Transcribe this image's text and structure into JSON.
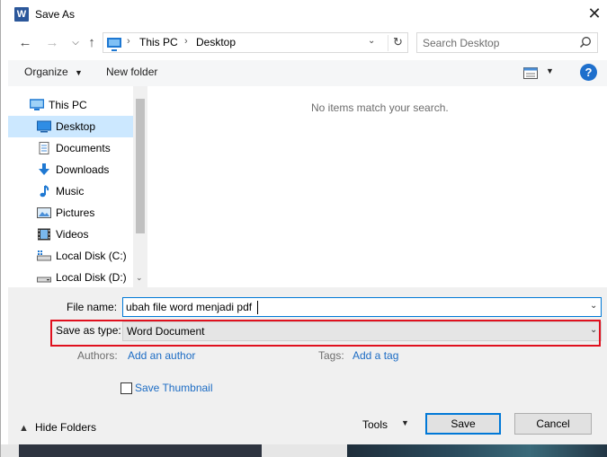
{
  "window": {
    "title": "Save As",
    "app_icon_letter": "W",
    "close_glyph": "✕"
  },
  "address_bar": {
    "breadcrumbs": [
      "This PC",
      "Desktop"
    ],
    "separator": "›"
  },
  "search": {
    "placeholder": "Search Desktop"
  },
  "toolbar": {
    "organize_label": "Organize",
    "new_folder_label": "New folder",
    "help_label": "?"
  },
  "sidebar": {
    "items": [
      {
        "label": "This PC",
        "icon": "pc-icon"
      },
      {
        "label": "Desktop",
        "icon": "desktop-icon",
        "selected": true
      },
      {
        "label": "Documents",
        "icon": "documents-icon"
      },
      {
        "label": "Downloads",
        "icon": "downloads-icon"
      },
      {
        "label": "Music",
        "icon": "music-icon"
      },
      {
        "label": "Pictures",
        "icon": "pictures-icon"
      },
      {
        "label": "Videos",
        "icon": "videos-icon"
      },
      {
        "label": "Local Disk (C:)",
        "icon": "disk-c-icon"
      },
      {
        "label": "Local Disk (D:)",
        "icon": "disk-d-icon"
      }
    ]
  },
  "content": {
    "empty_message": "No items match your search."
  },
  "form": {
    "file_name_label": "File name:",
    "file_name_value": "ubah file word menjadi pdf",
    "save_as_type_label": "Save as type:",
    "save_as_type_value": "Word Document",
    "authors_label": "Authors:",
    "add_author": "Add an author",
    "tags_label": "Tags:",
    "add_tag": "Add a tag",
    "save_thumbnail_label": "Save Thumbnail"
  },
  "footer": {
    "hide_folders_label": "Hide Folders",
    "tools_label": "Tools",
    "save_label": "Save",
    "cancel_label": "Cancel"
  },
  "colors": {
    "accent": "#0078d7",
    "link": "#1c6cc4",
    "selection": "#cce8ff",
    "highlight_box": "#e0101e"
  }
}
